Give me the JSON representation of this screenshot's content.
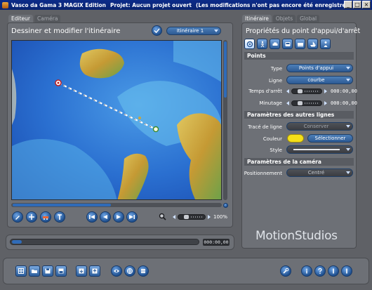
{
  "window": {
    "app_title": "Vasco da Gama 3 MAGIX Edition",
    "project": "Projet: Aucun projet ouvert",
    "notice": "(Les modifications n'ont pas encore été enregistrées!)",
    "buttons": [
      "_",
      "□",
      "×"
    ]
  },
  "left": {
    "tabs": [
      "Editeur",
      "Caméra"
    ],
    "title": "Dessiner et modifier l'itinéraire",
    "route_select": "Itinéraire 1",
    "zoom": "100%",
    "time": "000:00,00"
  },
  "right": {
    "tabs": [
      "Itinéraire",
      "Objets",
      "Global"
    ],
    "title": "Propriétés du point d'appui/d'arrêt",
    "sections": {
      "points": "Points",
      "lines": "Paramètres des autres lignes",
      "camera": "Paramètres de la caméra"
    },
    "fields": {
      "type_label": "Type",
      "type_value": "Points d'appui",
      "ligne_label": "Ligne",
      "ligne_value": "courbe",
      "temps_label": "Temps d'arrêt",
      "temps_value": "000:00,00",
      "minutage_label": "Minutage",
      "minutage_value": "000:00,00",
      "trace_label": "Tracé de ligne",
      "trace_value": "Conserver",
      "couleur_label": "Couleur",
      "couleur_button": "Sélectionner",
      "style_label": "Style",
      "position_label": "Positionnement",
      "position_value": "Centré"
    },
    "brand": "MotionStudios"
  },
  "colors": {
    "accent": "#2f6bb8",
    "line_color": "#f4df19"
  }
}
